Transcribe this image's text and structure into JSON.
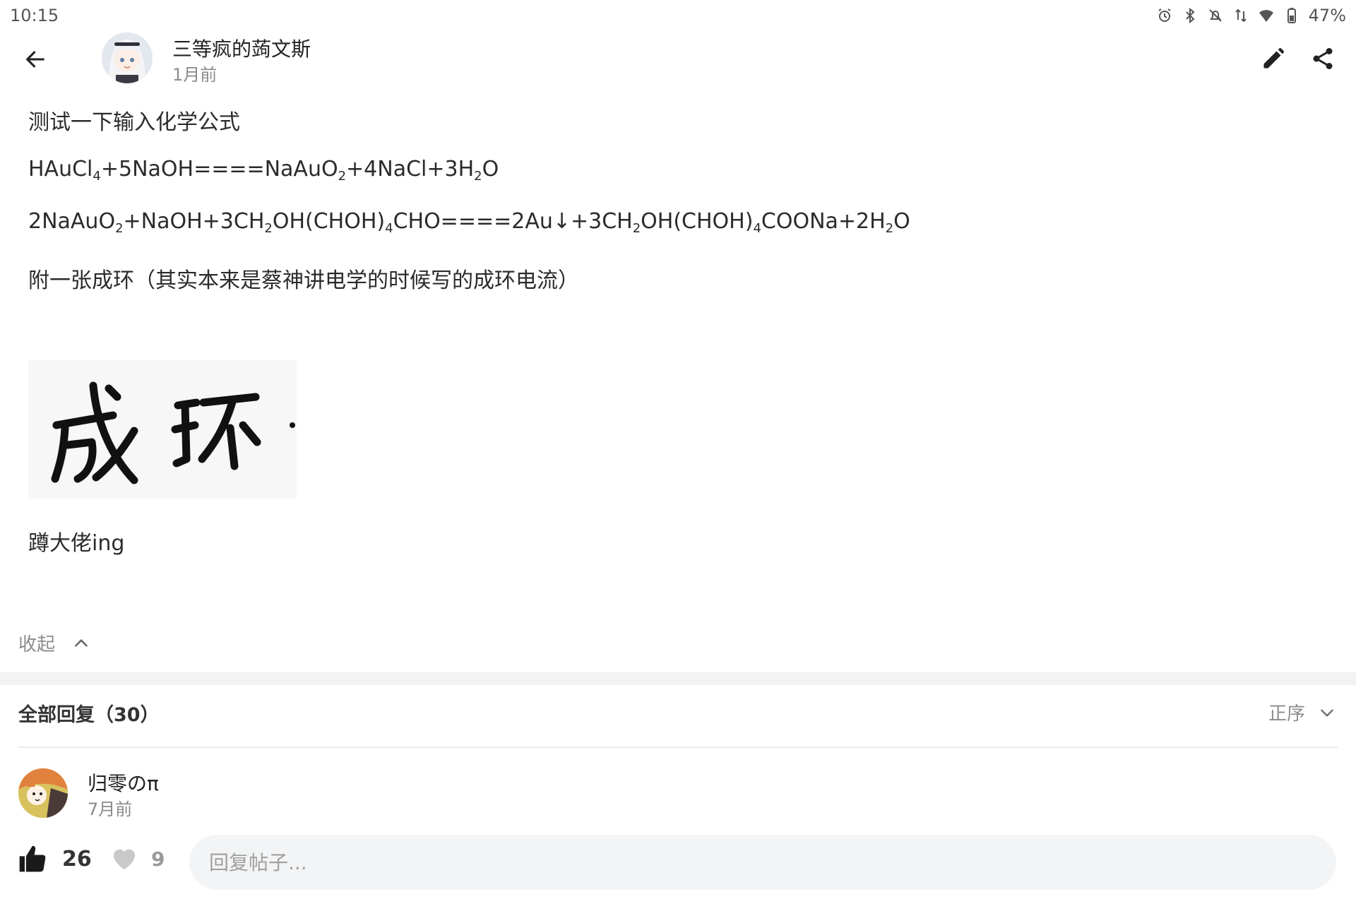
{
  "status_bar": {
    "time": "10:15",
    "battery": "47%",
    "icons": [
      "alarm-icon",
      "bluetooth-icon",
      "bell-off-icon",
      "data-arrows-icon",
      "wifi-icon",
      "battery-icon"
    ]
  },
  "header": {
    "author_name": "三等疯的蒟文斯",
    "post_time": "1月前",
    "icons": [
      "back-arrow-icon",
      "pencil-icon",
      "share-icon"
    ]
  },
  "post": {
    "line1": "测试一下输入化学公式",
    "eq1": [
      "HAuCl",
      "4",
      "+5NaOH====NaAuO",
      "2",
      "+4NaCl+3H",
      "2",
      "O"
    ],
    "eq2": [
      "2NaAuO",
      "2",
      "+NaOH+3CH",
      "2",
      "OH(CHOH)",
      "4",
      "CHO====2Au↓+3CH",
      "2",
      "OH(CHOH)",
      "4",
      "COONa+2H",
      "2",
      "O"
    ],
    "line4": "附一张成环（其实本来是蔡神讲电学的时候写的成环电流）",
    "image_text": "成环",
    "line5": "蹲大佬ing",
    "collapse_label": "收起"
  },
  "replies": {
    "title": "全部回复（30）",
    "sort_label": "正序",
    "first": {
      "name": "归零のπ",
      "time": "7月前"
    }
  },
  "actions": {
    "like_count": "26",
    "fav_count": "9",
    "reply_placeholder": "回复帖子..."
  },
  "colors": {
    "text": "#2b2b2b",
    "muted": "#8c8c8c",
    "divider": "#f2f3f4",
    "input_bg": "#f3f4f5"
  }
}
